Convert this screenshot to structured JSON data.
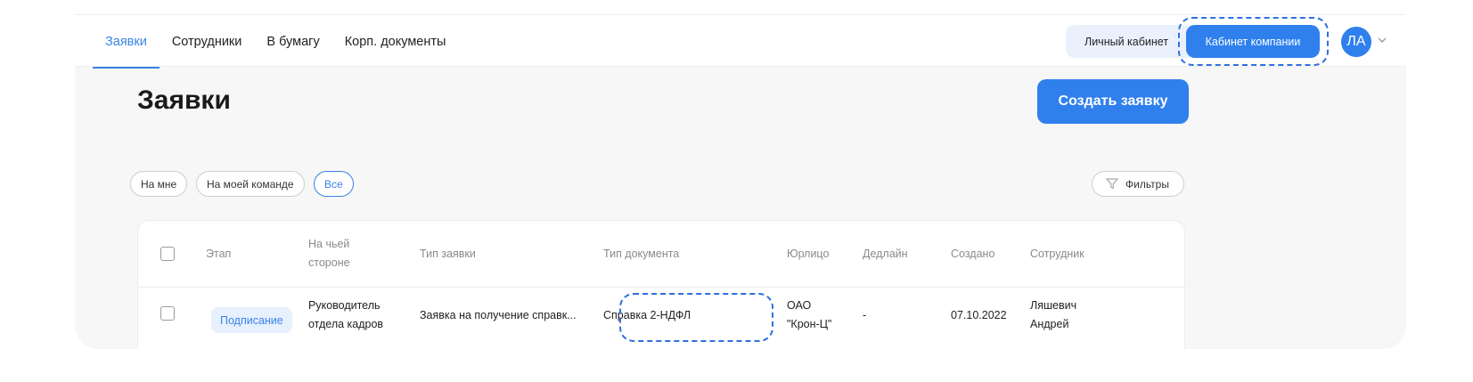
{
  "nav": {
    "items": [
      {
        "label": "Заявки",
        "active": true
      },
      {
        "label": "Сотрудники",
        "active": false
      },
      {
        "label": "В бумагу",
        "active": false
      },
      {
        "label": "Корп. документы",
        "active": false
      }
    ]
  },
  "account": {
    "personal_label": "Личный кабинет",
    "company_label": "Кабинет компании",
    "avatar_initials": "ЛА"
  },
  "page": {
    "title": "Заявки",
    "create_button": "Создать заявку"
  },
  "filters": {
    "chips": [
      {
        "label": "На мне",
        "active": false
      },
      {
        "label": "На моей команде",
        "active": false
      },
      {
        "label": "Все",
        "active": true
      }
    ],
    "filters_button": "Фильтры"
  },
  "table": {
    "columns": {
      "stage": "Этап",
      "side_line1": "На чьей",
      "side_line2": "стороне",
      "request_type": "Тип заявки",
      "doc_type": "Тип документа",
      "entity": "Юрлицо",
      "deadline": "Дедлайн",
      "created": "Создано",
      "employee": "Сотрудник"
    },
    "rows": [
      {
        "stage": "Подписание",
        "side_line1": "Руководитель",
        "side_line2": "отдела кадров",
        "request_type": "Заявка на получение справк...",
        "doc_type": "Справка 2-НДФЛ",
        "entity_line1": "ОАО",
        "entity_line2": "\"Крон-Ц\"",
        "deadline": "-",
        "created": "07.10.2022",
        "employee_line1": "Ляшевич",
        "employee_line2": "Андрей"
      }
    ]
  },
  "colors": {
    "accent": "#2f80ed",
    "highlight_dash": "#2f6fe0",
    "badge_bg": "#e7f0fd"
  }
}
